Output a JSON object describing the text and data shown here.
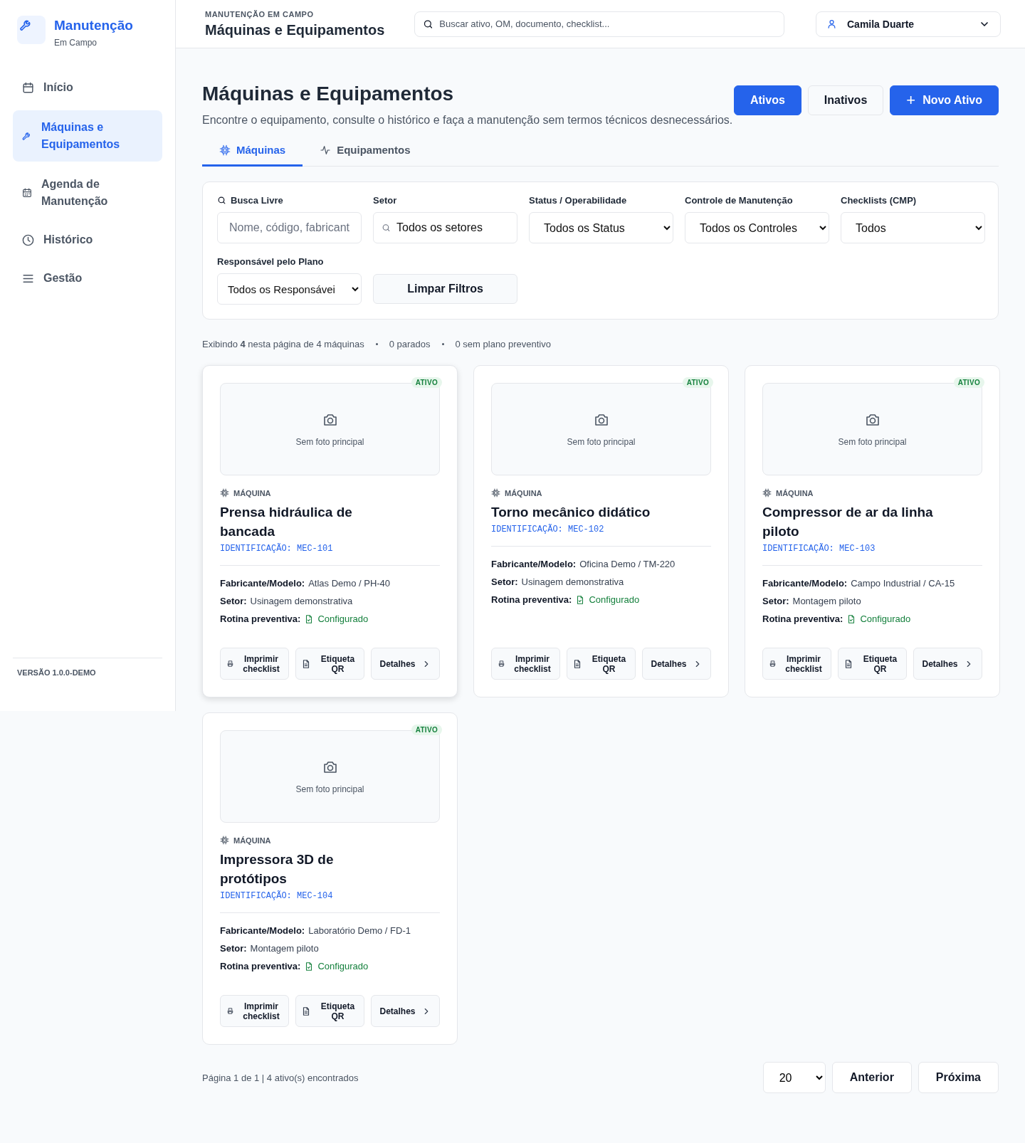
{
  "sidebar": {
    "brand": {
      "title": "Manutenção",
      "subtitle": "Em Campo"
    },
    "items": [
      {
        "label": "Início",
        "selected": false
      },
      {
        "label": "Máquinas e Equipamentos",
        "selected": true
      },
      {
        "label": "Agenda de Manutenção",
        "selected": false
      },
      {
        "label": "Histórico",
        "selected": false
      },
      {
        "label": "Gestão",
        "selected": false
      }
    ],
    "version": "VERSÃO 1.0.0-DEMO"
  },
  "header": {
    "eyebrow": "MANUTENÇÃO EM CAMPO",
    "title": "Máquinas e Equipamentos",
    "search": {
      "placeholder": "Buscar ativo, OM, documento, checklist..."
    },
    "user": "Camila Duarte"
  },
  "page": {
    "title": "Máquinas e Equipamentos",
    "subtitle": "Encontre o equipamento, consulte o histórico e faça a manutenção sem termos técnicos desnecessários.",
    "status_toggle": [
      {
        "label": "Ativos",
        "selected": true
      },
      {
        "label": "Inativos",
        "selected": false
      }
    ],
    "new_button": {
      "label": "Novo Ativo",
      "icon": "+"
    }
  },
  "tabs": [
    {
      "label": "Máquinas",
      "selected": true
    },
    {
      "label": "Equipamentos",
      "selected": false
    }
  ],
  "filters": [
    {
      "kind": "text",
      "label": "Busca Livre",
      "placeholder": "Nome, código, fabricant"
    },
    {
      "kind": "search",
      "label": "Setor",
      "value": "Todos os setores"
    },
    {
      "kind": "select",
      "label": "Status / Operabilidade",
      "value": "Todos os Status"
    },
    {
      "kind": "select",
      "label": "Controle de Manutenção",
      "value": "Todos os Controles"
    },
    {
      "kind": "select",
      "label": "Checklists (CMP)",
      "value": "Todos"
    },
    {
      "kind": "select",
      "label": "Responsável pelo Plano",
      "value": "Todos os Responsávei"
    },
    {
      "kind": "button",
      "label": "Limpar Filtros"
    }
  ],
  "summary": [
    "Exibindo **4** nesta página de 4 máquinas",
    "0 parados",
    "0 sem plano preventivo"
  ],
  "cards": [
    {
      "status": "ATIVO",
      "hovered": true,
      "photo": "Sem foto principal",
      "type": "MÁQUINA",
      "name": "Prensa hidráulica de bancada",
      "id": "IDENTIFICAÇÃO: MEC-101",
      "details": [
        {
          "label": "Fabricante/Modelo:",
          "value": "Atlas Demo / PH-40"
        },
        {
          "label": "Setor:",
          "value": "Usinagem demonstrativa"
        },
        {
          "label": "Rotina preventiva:",
          "value": "Configurado",
          "kind": "ok"
        }
      ],
      "actions": [
        {
          "label": "Imprimir checklist"
        },
        {
          "label": "Etiqueta QR"
        },
        {
          "label": "Detalhes"
        }
      ]
    },
    {
      "status": "ATIVO",
      "hovered": false,
      "photo": "Sem foto principal",
      "type": "MÁQUINA",
      "name": "Torno mecânico didático",
      "id": "IDENTIFICAÇÃO: MEC-102",
      "details": [
        {
          "label": "Fabricante/Modelo:",
          "value": "Oficina Demo / TM-220"
        },
        {
          "label": "Setor:",
          "value": "Usinagem demonstrativa"
        },
        {
          "label": "Rotina preventiva:",
          "value": "Configurado",
          "kind": "ok"
        }
      ],
      "actions": [
        {
          "label": "Imprimir checklist"
        },
        {
          "label": "Etiqueta QR"
        },
        {
          "label": "Detalhes"
        }
      ]
    },
    {
      "status": "ATIVO",
      "hovered": false,
      "photo": "Sem foto principal",
      "type": "MÁQUINA",
      "name": "Compressor de ar da linha piloto",
      "id": "IDENTIFICAÇÃO: MEC-103",
      "details": [
        {
          "label": "Fabricante/Modelo:",
          "value": "Campo Industrial / CA-15"
        },
        {
          "label": "Setor:",
          "value": "Montagem piloto"
        },
        {
          "label": "Rotina preventiva:",
          "value": "Configurado",
          "kind": "ok"
        }
      ],
      "actions": [
        {
          "label": "Imprimir checklist"
        },
        {
          "label": "Etiqueta QR"
        },
        {
          "label": "Detalhes"
        }
      ]
    },
    {
      "status": "ATIVO",
      "hovered": false,
      "photo": "Sem foto principal",
      "type": "MÁQUINA",
      "name": "Impressora 3D de protótipos",
      "id": "IDENTIFICAÇÃO: MEC-104",
      "details": [
        {
          "label": "Fabricante/Modelo:",
          "value": "Laboratório Demo / FD-1"
        },
        {
          "label": "Setor:",
          "value": "Montagem piloto"
        },
        {
          "label": "Rotina preventiva:",
          "value": "Configurado",
          "kind": "ok"
        }
      ],
      "actions": [
        {
          "label": "Imprimir checklist"
        },
        {
          "label": "Etiqueta QR"
        },
        {
          "label": "Detalhes"
        }
      ]
    }
  ],
  "pagination": {
    "info": "Página 1 de 1 | 4 ativo(s) encontrados",
    "page_size": "20",
    "buttons": [
      "Anterior",
      "Próxima"
    ]
  }
}
